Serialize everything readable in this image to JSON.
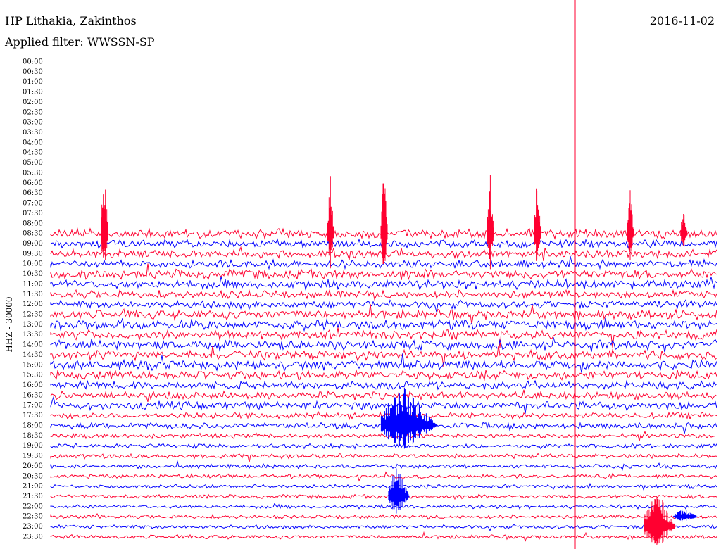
{
  "header": {
    "station": "HP Lithakia, Zakinthos",
    "filter": "Applied filter: WWSSN-SP",
    "date": "2016-11-02"
  },
  "chart_data": {
    "type": "line",
    "title": "HP Lithakia, Zakinthos",
    "subtitle": "Applied filter: WWSSN-SP",
    "date": "2016-11-02",
    "ylabel": "HHZ - 30000",
    "row_labels": [
      "00:00",
      "00:30",
      "01:00",
      "01:30",
      "02:00",
      "02:30",
      "03:00",
      "03:30",
      "04:00",
      "04:30",
      "05:00",
      "05:30",
      "06:00",
      "06:30",
      "07:00",
      "07:30",
      "08:00",
      "08:30",
      "09:00",
      "09:30",
      "10:00",
      "10:30",
      "11:00",
      "11:30",
      "12:00",
      "12:30",
      "13:00",
      "13:30",
      "14:00",
      "14:30",
      "15:00",
      "15:30",
      "16:00",
      "16:30",
      "17:00",
      "17:30",
      "18:00",
      "18:30",
      "19:00",
      "19:30",
      "20:00",
      "20:30",
      "21:00",
      "21:30",
      "22:00",
      "22:30",
      "23:00",
      "23:30"
    ],
    "first_trace_row": "08:30",
    "first_trace_color": "red",
    "colors": {
      "red": "#ff0030",
      "blue": "#0000ff"
    },
    "row_amplitude": [
      0,
      0,
      0,
      0,
      0,
      0,
      0,
      0,
      0,
      0,
      0,
      0,
      0,
      0,
      0,
      0,
      0,
      6,
      5,
      5,
      5,
      6,
      6,
      5,
      5,
      6,
      6,
      6,
      6,
      6,
      6,
      6,
      5,
      5,
      5,
      4,
      4,
      3,
      3,
      3,
      2.5,
      2.5,
      2.5,
      2.5,
      2.5,
      2.5,
      2.5,
      2.5
    ],
    "events": [
      {
        "row": "08:30",
        "pos": 0.08,
        "height": 110
      },
      {
        "row": "08:30",
        "pos": 0.42,
        "height": 90
      },
      {
        "row": "08:30",
        "pos": 0.5,
        "height": 100
      },
      {
        "row": "08:30",
        "pos": 0.66,
        "height": 90
      },
      {
        "row": "08:30",
        "pos": 0.73,
        "height": 85
      },
      {
        "row": "08:30",
        "pos": 0.87,
        "height": 65
      },
      {
        "row": "08:30",
        "pos": 0.95,
        "height": 35
      },
      {
        "row": "18:00",
        "pos": 0.53,
        "height": 60,
        "color": "blue",
        "width": 32
      },
      {
        "row": "21:30",
        "pos": 0.52,
        "height": 45,
        "color": "blue",
        "width": 12
      },
      {
        "row": "23:00",
        "pos": 0.91,
        "height": 55,
        "color": "red",
        "width": 18
      },
      {
        "row": "22:30",
        "pos": 0.95,
        "height": 12,
        "color": "blue",
        "width": 14
      }
    ],
    "vertical_line": {
      "pos": 0.787,
      "color": "red"
    }
  }
}
